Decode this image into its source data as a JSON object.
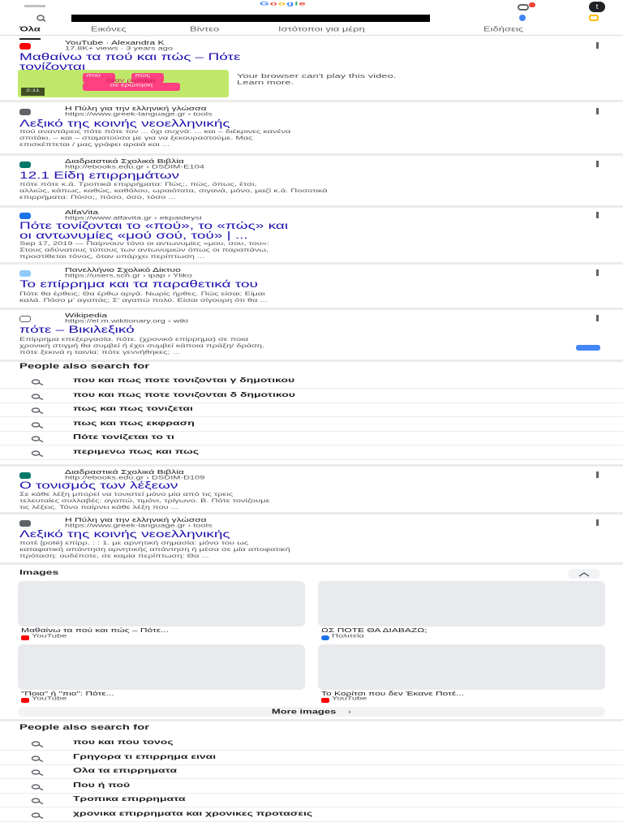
{
  "header": {
    "logo_letters": [
      "G",
      "o",
      "o",
      "g",
      "l",
      "e"
    ],
    "logo_colors": [
      "#4285f4",
      "#ea4335",
      "#fbbc05",
      "#4285f4",
      "#34a853",
      "#ea4335"
    ],
    "avatar_initial": "t",
    "search_query_redacted": true
  },
  "tabs": [
    "Όλα",
    "Εικόνες",
    "Βίντεο",
    "Ιστότοποι για μέρη",
    "Ειδήσεις"
  ],
  "results": {
    "video": {
      "site": "YouTube · Alexandra K",
      "meta": "17.8K+ views · 3 years ago",
      "title_line1": "Μαθαίνω τα πού και πώς – Πότε",
      "title_line2": "τονίζονται",
      "thumb_pill1": "πού",
      "thumb_pill2": "πώς",
      "thumb_line2": "όταν ρωτάμε",
      "thumb_line3": "σε ερώτηση",
      "duration": "2:11",
      "player_msg1": "Your browser can't play this video.",
      "player_msg2": "Learn more."
    },
    "r1": {
      "site": "Η Πύλη για την ελληνική γλώσσα",
      "url": "https://www.greek-language.gr › tools",
      "title": "Λεξικό της κοινής νεοελληνικής",
      "snip1": "πού αναντάρεις πότε πότε τον ... όχι συχνά: ... και – διέκρινες κανένα",
      "snip2": "σπιτάκι. – και – σταματούσα με για να ξεκουραστούμε. Μας",
      "snip3": "επισκέπτεται / μας γράφει αραιά και ..."
    },
    "r2": {
      "site": "Διαδραστικά Σχολικά Βιβλία",
      "url": "http://ebooks.edu.gr › DSDIM-E104",
      "title": "12.1 Είδη επιρρημάτων",
      "snip1": "πότε πότε κ.ά. Τροπικά επιρρήματα: Πώς;, πώς, όπως, έτσι,",
      "snip2": "αλλιώς, κάπως, καθώς, καθόλου, ωραιότατα, σιγανά, μόνο, μαζί κ.ά. Ποσοτικά",
      "snip3": "επιρρήματα: Πόσο;, πόσο, όσο, τόσο ..."
    },
    "r3": {
      "site": "AlfaVita",
      "url": "https://www.alfavita.gr › ekpaideysi",
      "title_line1": "Πότε τονίζονται το «πού», το «πώς» και",
      "title_line2": "οι αντωνυμίες «μού σού, τού» | ...",
      "snip1": "Sep 17, 2019 — Παίρνουν τόνο οι αντωνυμίες «μου, σου, του»:",
      "snip2": "Στους αδύνατους τύπους των αντωνυμιών όπως οι παραπάνω,",
      "snip3": "προστίθεται τόνος, όταν υπάρχει περίπτωση ..."
    },
    "r4": {
      "site": "Πανελλήνιο Σχολικό Δίκτυο",
      "url": "https://users.sch.gr › ipap › Yliko",
      "title": "Το επίρρημα και τα παραθετικά του",
      "snip1": "Πότε θα έρθεις; Θα έρθω αργά. Νωρίς ήρθες. Πώς είσαι; Είμαι",
      "snip2": "καλά. Πόσο μ' αγαπάς; Σ' αγαπώ πολύ. Είσαι σίγουρη ότι θα ..."
    },
    "r5": {
      "site": "Wikipedia",
      "url": "https://el.m.wiktionary.org › wiki",
      "title": "πότε – Βικιλεξικό",
      "snip1": "Επίρρημα επεξεργασία. πότε. (χρονικό επίρρημα) σε ποια",
      "snip2": "χρονική στιγμή θα συμβεί ή έχει συμβεί κάποια πράξη/ δράση.",
      "snip3": "πότε ξεκινά η ταινία; πότε γεννήθηκες; ..."
    },
    "r6": {
      "site": "Διαδραστικά Σχολικά Βιβλία",
      "url": "http://ebooks.edu.gr › DSDIM-D109",
      "title": "Ο τονισμός των λέξεων",
      "snip1": "Σε κάθε λέξη μπορεί να τονιστεί μόνο μία από τις τρεις",
      "snip2": "τελευταίες συλλαβές: αγαπώ, τιμόνι, τρίγωνο. Β. Πότε τονίζουμε",
      "snip3": "τις λέξεις. Τόνο παίρνει κάθε λέξη που ..."
    },
    "r7": {
      "site": "Η Πύλη για την ελληνική γλώσσα",
      "url": "https://www.greek-language.gr › tools",
      "title": "Λεξικό της κοινής νεοελληνικής",
      "snip1": "ποτέ [poté] επίρρ. : : 1. με αρνητική σημασία: μόνο του ως",
      "snip2": "καταφατική απάντηση αρνητικής απάντηση ή μέσα σε μία αποφατική",
      "snip3": "πρόταση: ουδέποτε, σε καμία περίπτωση: Θα ..."
    }
  },
  "people_also_search_1": {
    "heading": "People also search for",
    "items": [
      "που και πως ποτε τονιζονται γ δημοτικου",
      "που και πως ποτε τονιζονται δ δημοτικου",
      "πως και πως τονιζεται",
      "πως και πως εκφραση",
      "Πότε τονίζεται το τι",
      "περιμενω πως και πως"
    ]
  },
  "images": {
    "heading": "Images",
    "cards": [
      {
        "caption": "Μαθαίνω τα πού και πώς – Πότε...",
        "source": "YouTube",
        "src_type": "yt"
      },
      {
        "caption": "ΩΣ ΠΟΤΕ ΘΑ ΔΙΑΒΑΖΩ;",
        "source": "Πολιτεία",
        "src_type": "polit"
      },
      {
        "caption": "\"Ποιο\" ή \"πιο\": Πότε...",
        "source": "YouTube",
        "src_type": "yt"
      },
      {
        "caption": "Το Κορίτσι που δεν Έκανε Ποτέ...",
        "source": "YouTube",
        "src_type": "yt"
      }
    ],
    "more_label": "More images",
    "more_arrow": "›"
  },
  "people_also_search_2": {
    "heading": "People also search for",
    "items": [
      "που και που τονος",
      "Γρηγορα τι επιρρημα ειναι",
      "Ολα τα επιρρηματα",
      "Που ή πού",
      "Τροπικα επιρρηματα",
      "χρονικα επιρρηματα και χρονικες προτασεις"
    ]
  },
  "colors": {
    "link": "#1a0dab",
    "divider": "#ebebeb",
    "youtube": "#ff0000"
  }
}
